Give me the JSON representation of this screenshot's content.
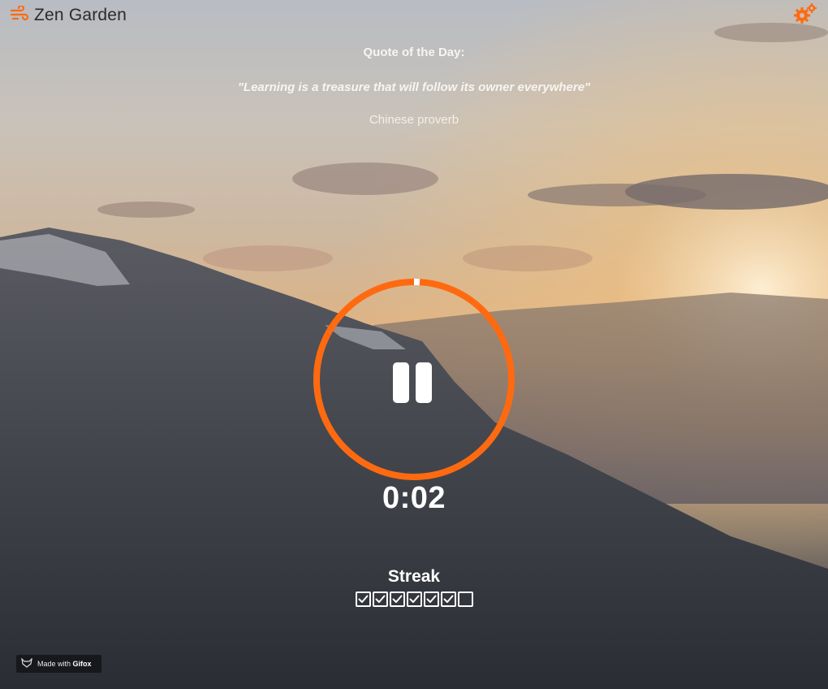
{
  "app": {
    "name": "Zen Garden",
    "logo_icon": "wind-icon",
    "accent": "#ff6a10"
  },
  "toolbar": {
    "settings_icon": "gears-icon"
  },
  "quote": {
    "heading": "Quote of the Day:",
    "text": "\"Learning is a treasure that will follow its owner everywhere\"",
    "author": "Chinese proverb"
  },
  "timer": {
    "elapsed": "0:02",
    "ring_color": "#ff6a10",
    "control_icon": "pause-icon",
    "state": "running"
  },
  "streak": {
    "title": "Streak",
    "days": [
      true,
      true,
      true,
      true,
      true,
      true,
      false
    ]
  },
  "badge": {
    "prefix": "Made with",
    "brand": "Gifox"
  }
}
